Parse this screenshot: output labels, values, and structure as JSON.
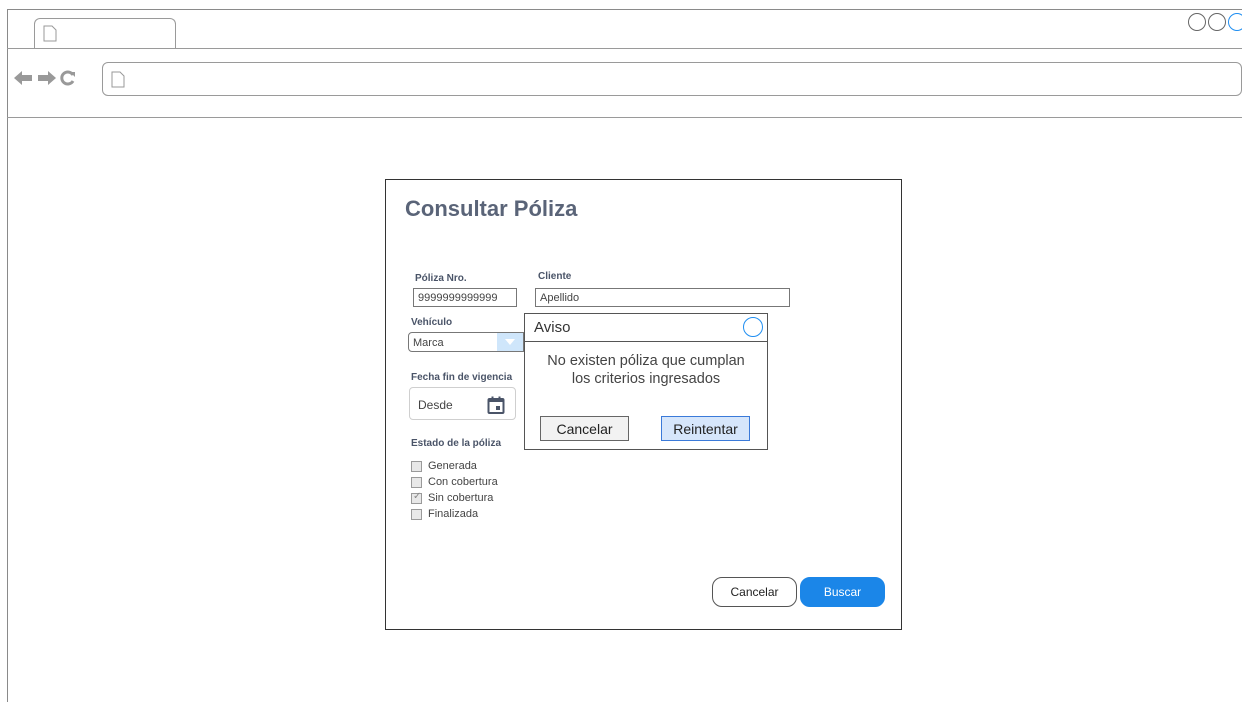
{
  "browser": {
    "tab_icon": "page-icon",
    "window_buttons": [
      "circle-icon",
      "circle-icon",
      "circle-icon"
    ],
    "nav_icons": [
      "back-arrow-icon",
      "forward-arrow-icon",
      "reload-icon"
    ],
    "address_value": ""
  },
  "form": {
    "title": "Consultar Póliza",
    "poliza": {
      "label": "Póliza Nro.",
      "value": "9999999999999"
    },
    "cliente": {
      "label": "Cliente",
      "value": "Apellido"
    },
    "vehiculo": {
      "label": "Vehículo",
      "selected": "Marca"
    },
    "fecha": {
      "label": "Fecha fin de vigencia",
      "desde": "Desde"
    },
    "estado": {
      "label": "Estado de la póliza",
      "options": [
        {
          "label": "Generada",
          "checked": false
        },
        {
          "label": "Con cobertura",
          "checked": false
        },
        {
          "label": "Sin cobertura",
          "checked": true
        },
        {
          "label": "Finalizada",
          "checked": false
        }
      ]
    },
    "buttons": {
      "cancel": "Cancelar",
      "search": "Buscar"
    }
  },
  "dialog": {
    "title": "Aviso",
    "message_line1": "No existen póliza que cumplan",
    "message_line2": "los criterios ingresados",
    "cancel": "Cancelar",
    "retry": "Reintentar"
  },
  "colors": {
    "primary": "#1b86e8",
    "title": "#5a6478",
    "retry_bg": "#d6e6fb"
  }
}
